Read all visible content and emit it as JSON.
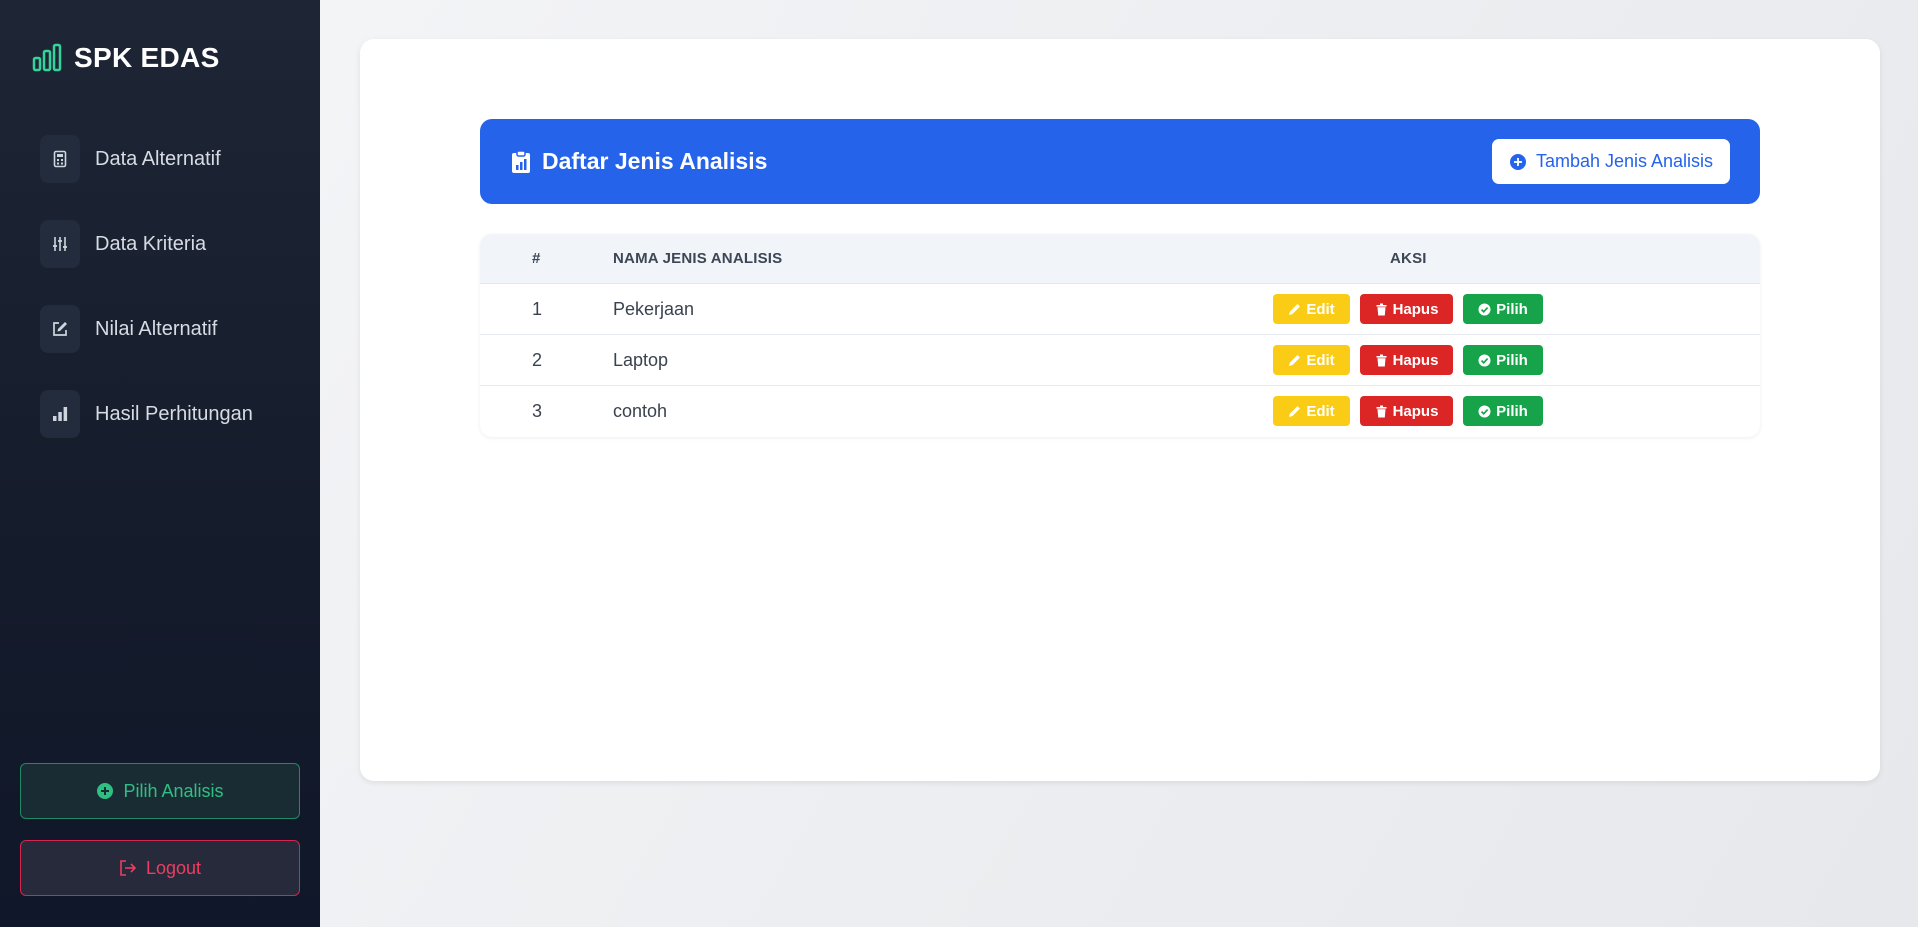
{
  "sidebar": {
    "brand": "SPK EDAS",
    "brand_icon": "bar-chart-icon",
    "brand_icon_color": "#34d399",
    "items": [
      {
        "label": "Data Alternatif",
        "icon": "calculator-icon"
      },
      {
        "label": "Data Kriteria",
        "icon": "sliders-icon"
      },
      {
        "label": "Nilai Alternatif",
        "icon": "edit-icon"
      },
      {
        "label": "Hasil Perhitungan",
        "icon": "signal-bars-icon"
      }
    ],
    "pilih_analisis_label": "Pilih Analisis",
    "logout_label": "Logout"
  },
  "main": {
    "header_title": "Daftar Jenis Analisis",
    "add_button_label": "Tambah Jenis Analisis",
    "accent_color": "#2563eb",
    "table": {
      "columns": [
        "#",
        "NAMA JENIS ANALISIS",
        "AKSI"
      ],
      "rows": [
        {
          "no": "1",
          "name": "Pekerjaan"
        },
        {
          "no": "2",
          "name": "Laptop"
        },
        {
          "no": "3",
          "name": "contoh"
        }
      ],
      "actions": {
        "edit": "Edit",
        "hapus": "Hapus",
        "pilih": "Pilih"
      },
      "action_colors": {
        "edit": "#facc15",
        "hapus": "#dc2626",
        "pilih": "#16a34a"
      }
    }
  }
}
